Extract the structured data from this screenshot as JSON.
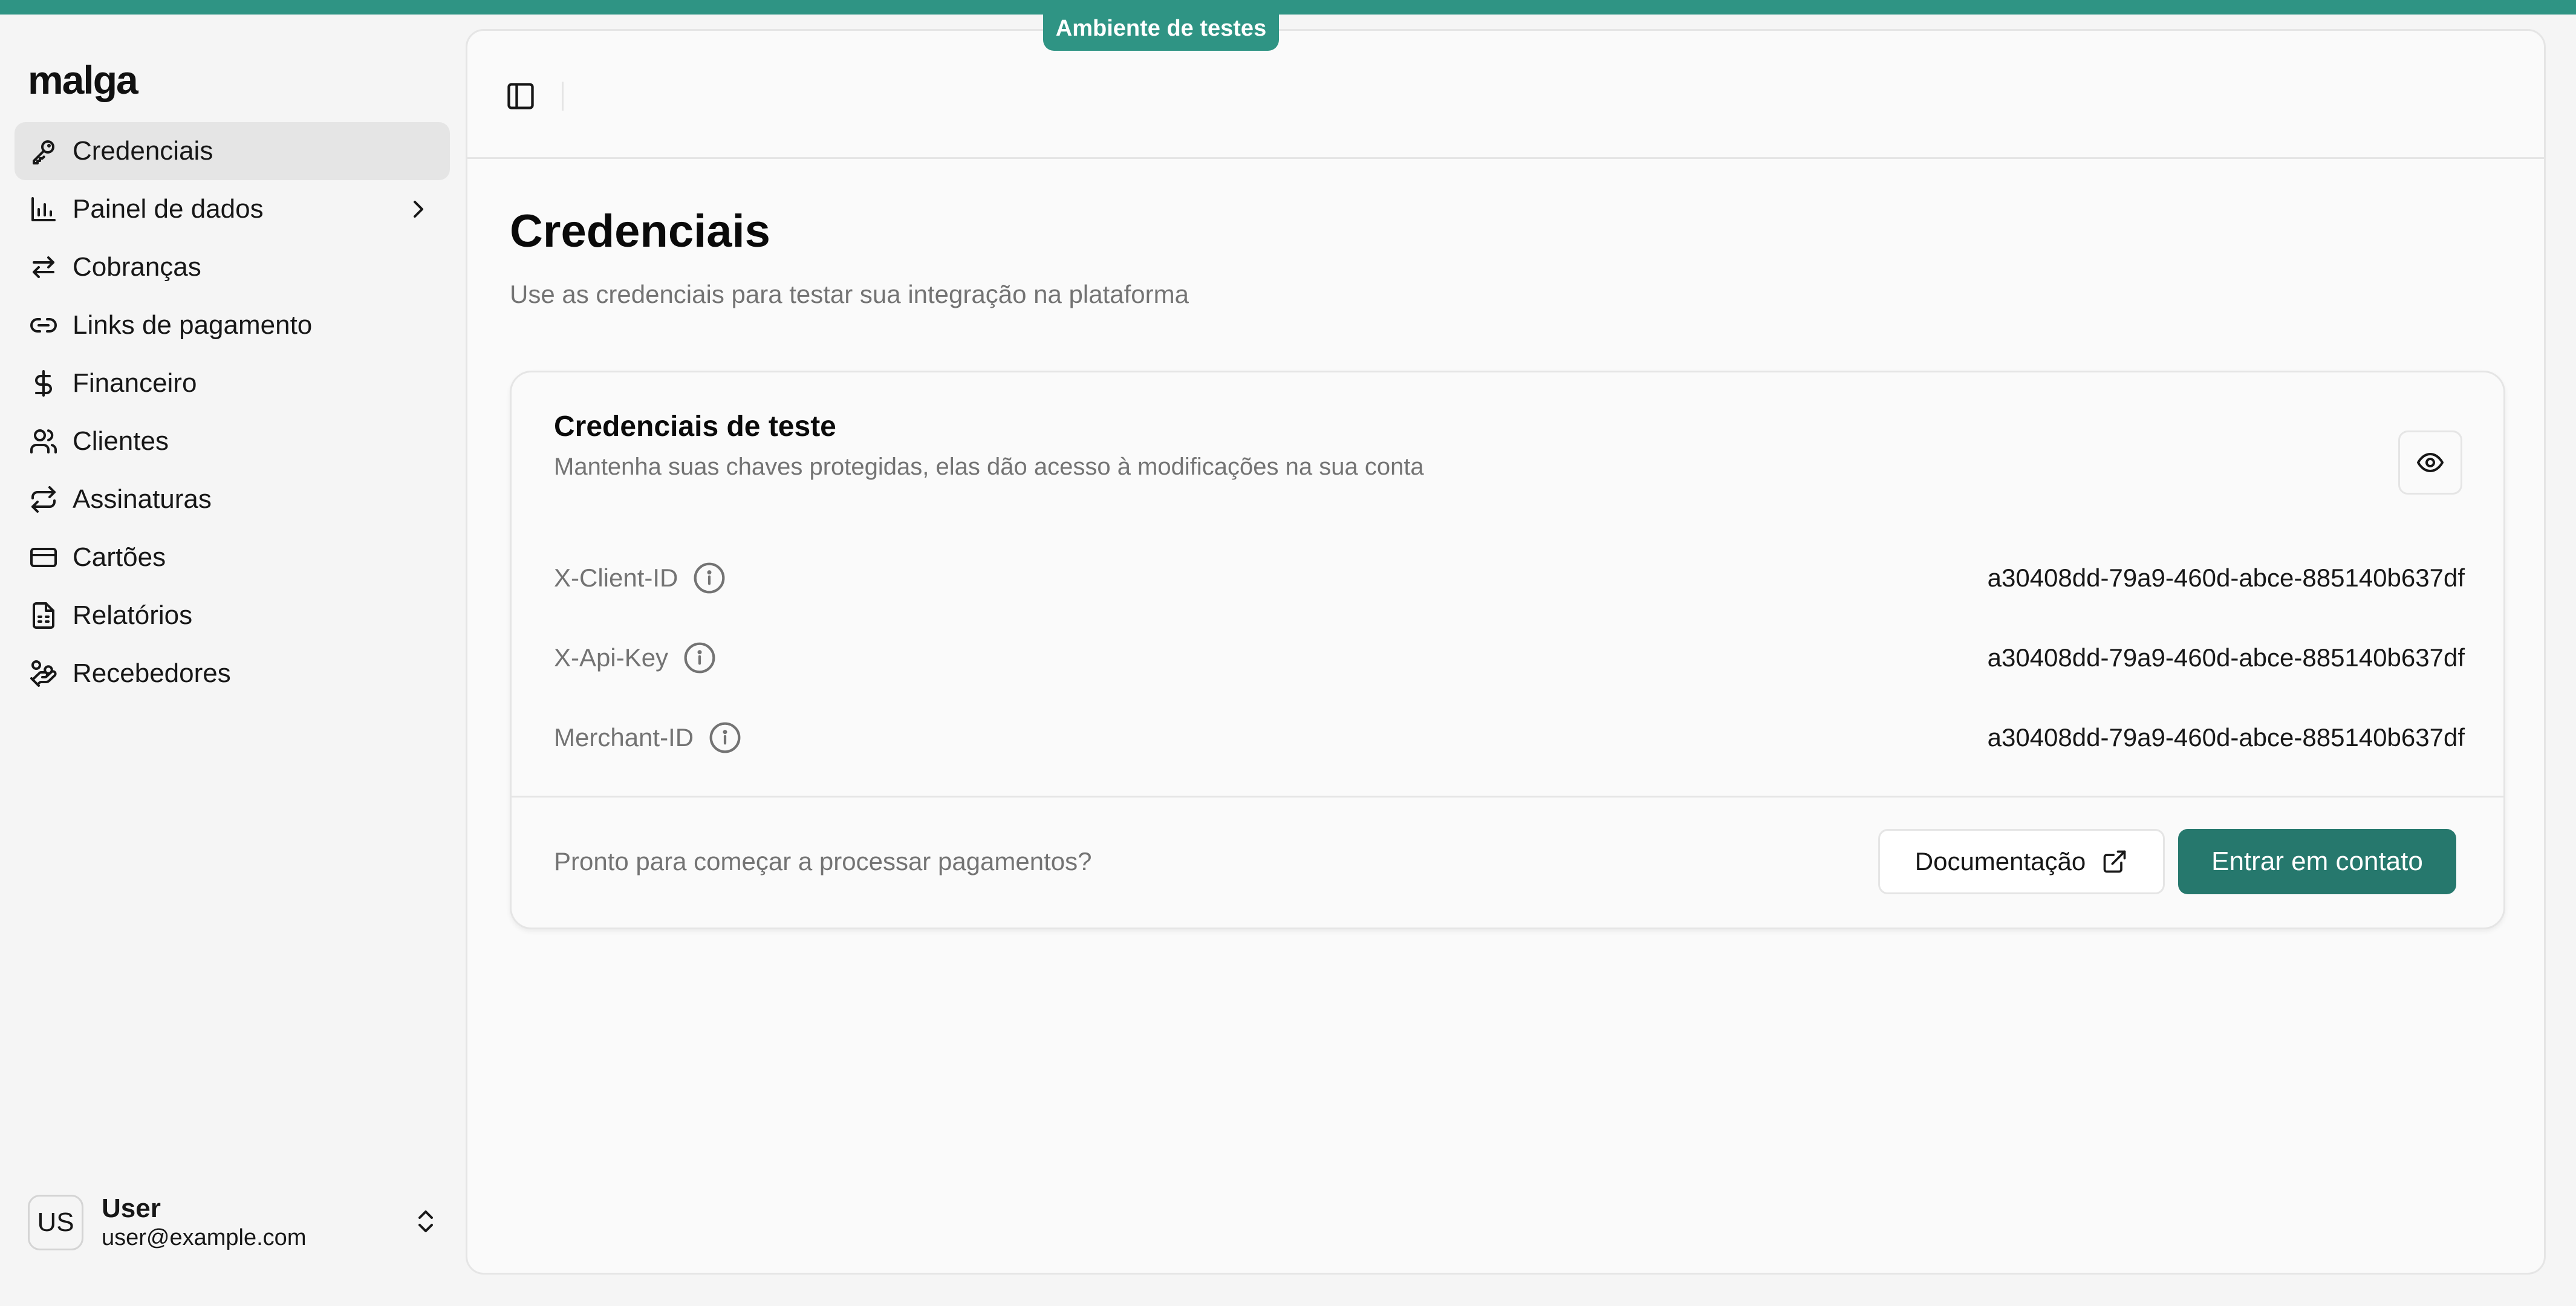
{
  "environment": {
    "badge": "Ambiente de testes"
  },
  "brand": {
    "logo": "malga",
    "accent": "#2f9484",
    "primary_button": "#26786d"
  },
  "sidebar": {
    "items": [
      {
        "label": "Credenciais",
        "icon": "key-icon",
        "active": true
      },
      {
        "label": "Painel de dados",
        "icon": "bar-chart-icon",
        "expandable": true
      },
      {
        "label": "Cobranças",
        "icon": "arrows-left-right-icon"
      },
      {
        "label": "Links de pagamento",
        "icon": "link-icon"
      },
      {
        "label": "Financeiro",
        "icon": "dollar-icon"
      },
      {
        "label": "Clientes",
        "icon": "users-icon"
      },
      {
        "label": "Assinaturas",
        "icon": "repeat-icon"
      },
      {
        "label": "Cartões",
        "icon": "credit-card-icon"
      },
      {
        "label": "Relatórios",
        "icon": "report-icon"
      },
      {
        "label": "Recebedores",
        "icon": "hand-coins-icon"
      }
    ]
  },
  "user": {
    "initials": "US",
    "name": "User",
    "email": "user@example.com"
  },
  "page": {
    "title": "Credenciais",
    "subtitle": "Use as credenciais para testar sua integração na plataforma"
  },
  "card": {
    "title": "Credenciais de teste",
    "description": "Mantenha suas chaves protegidas, elas dão acesso à modificações na sua conta",
    "credentials": [
      {
        "label": "X-Client-ID",
        "value": "a30408dd-79a9-460d-abce-885140b637df"
      },
      {
        "label": "X-Api-Key",
        "value": "a30408dd-79a9-460d-abce-885140b637df"
      },
      {
        "label": "Merchant-ID",
        "value": "a30408dd-79a9-460d-abce-885140b637df"
      }
    ],
    "footer": {
      "text": "Pronto para começar a processar pagamentos?",
      "doc_button": "Documentação",
      "contact_button": "Entrar em contato"
    }
  }
}
